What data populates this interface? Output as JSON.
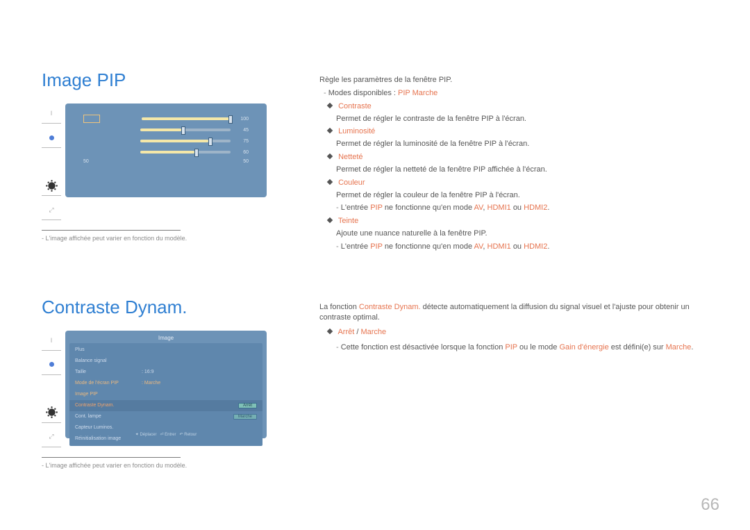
{
  "page_number": "66",
  "footnote": "L'image affichée peut varier en fonction du modèle.",
  "section1": {
    "title": "Image PIP",
    "osd": {
      "values": {
        "contrast": "100",
        "brightness": "45",
        "sharpness": "75",
        "color": "60",
        "tint": "50",
        "tint_left": "50"
      }
    },
    "intro": "Règle les paramètres de la fenêtre PIP.",
    "modes_prefix": "Modes disponibles :",
    "modes_value": "PIP Marche",
    "items": {
      "bullet": "Ht",
      "contrast": {
        "label": "Contraste",
        "desc": "Permet de régler le contraste de la fenêtre PIP à l'écran."
      },
      "brightness": {
        "label": "Luminosité",
        "desc": "Permet de régler la luminosité de la fenêtre PIP à l'écran."
      },
      "sharpness": {
        "label": "Netteté",
        "desc": "Permet de régler la netteté de la fenêtre PIP affichée à l'écran."
      },
      "color": {
        "label": "Couleur",
        "desc": "Permet de régler la couleur de la fenêtre PIP à l'écran."
      },
      "color_note": {
        "pre": "L'entrée",
        "pip": "PIP",
        "mid": "ne fonctionne qu'en mode",
        "av": "AV",
        "sep": ",",
        "h1": "HDMI1",
        "or": "ou",
        "h2": "HDMI2",
        "dot": "."
      },
      "tint": {
        "label": "Teinte",
        "desc": "Ajoute une nuance naturelle à la fenêtre PIP."
      },
      "tint_note": {
        "pre": "L'entrée",
        "pip": "PIP",
        "mid": "ne fonctionne qu'en mode",
        "av": "AV",
        "sep": ",",
        "h1": "HDMI1",
        "or": "ou",
        "h2": "HDMI2",
        "dot": "."
      }
    }
  },
  "section2": {
    "title": "Contraste Dynam.",
    "osd": {
      "title": "Image",
      "rows": {
        "plus": "Plus",
        "balance": "Balance signal",
        "size": {
          "label": "Taille",
          "value": ": 16:9"
        },
        "pip_mode": {
          "label": "Mode de l'écran PIP",
          "value": ": Marche"
        },
        "image_pip": "Image PIP",
        "dynamic": {
          "label": "Contraste Dynam.",
          "value": "Arrêt"
        },
        "lamp": {
          "label": "Cont. lampe",
          "value": "Marche"
        },
        "sensor": "Capteur Luminos.",
        "reset": "Réinitialisation image"
      },
      "bottom": {
        "move": "Déplacer",
        "enter": "Entrer",
        "return": "Retour"
      }
    },
    "intro": {
      "pre": "La fonction",
      "kw": "Contraste Dynam.",
      "post": "détecte automatiquement la diffusion du signal visuel et l'ajuste pour obtenir un contraste optimal."
    },
    "option": {
      "bullet": "Ht",
      "off": "Arrêt",
      "sep": "/",
      "on": "Marche"
    },
    "note": {
      "pre": "Cette fonction est désactivée lorsque la fonction",
      "pip": "PIP",
      "mid": "ou le mode",
      "gain": "Gain d'énergie",
      "mid2": "est défini(e) sur",
      "on": "Marche",
      "dot": "."
    }
  }
}
